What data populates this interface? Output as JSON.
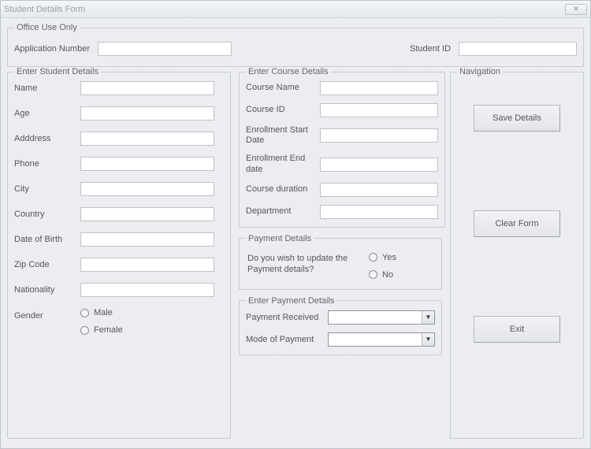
{
  "window": {
    "title": "Student Details Form"
  },
  "office": {
    "legend": "Office Use Only",
    "appnum_label": "Application Number",
    "appnum_value": "",
    "studentid_label": "Student ID",
    "studentid_value": ""
  },
  "student": {
    "legend": "Enter Student Details",
    "fields": [
      {
        "label": "Name",
        "value": ""
      },
      {
        "label": "Age",
        "value": ""
      },
      {
        "label": "Adddress",
        "value": ""
      },
      {
        "label": "Phone",
        "value": ""
      },
      {
        "label": "City",
        "value": ""
      },
      {
        "label": "Country",
        "value": ""
      },
      {
        "label": "Date of Birth",
        "value": ""
      },
      {
        "label": "Zip Code",
        "value": ""
      },
      {
        "label": "Nationality",
        "value": ""
      }
    ],
    "gender_label": "Gender",
    "gender_options": [
      "Male",
      "Female"
    ]
  },
  "course": {
    "legend": "Enter Course Details",
    "fields": [
      {
        "label": "Course Name",
        "value": ""
      },
      {
        "label": "Course ID",
        "value": ""
      },
      {
        "label": "Enrollment Start Date",
        "value": ""
      },
      {
        "label": "Enrollment End date",
        "value": ""
      },
      {
        "label": "Course duration",
        "value": ""
      },
      {
        "label": "Department",
        "value": ""
      }
    ]
  },
  "payment_question": {
    "legend": "Payment Details",
    "prompt": "Do you wish to update the Payment details?",
    "options": [
      "Yes",
      "No"
    ]
  },
  "payment_details": {
    "legend": "Enter Payment Details",
    "payment_received_label": "Payment Received",
    "payment_received_value": "",
    "mode_label": "Mode of Payment",
    "mode_value": ""
  },
  "nav": {
    "legend": "Navigation",
    "save_label": "Save Details",
    "clear_label": "Clear Form",
    "exit_label": "Exit"
  }
}
